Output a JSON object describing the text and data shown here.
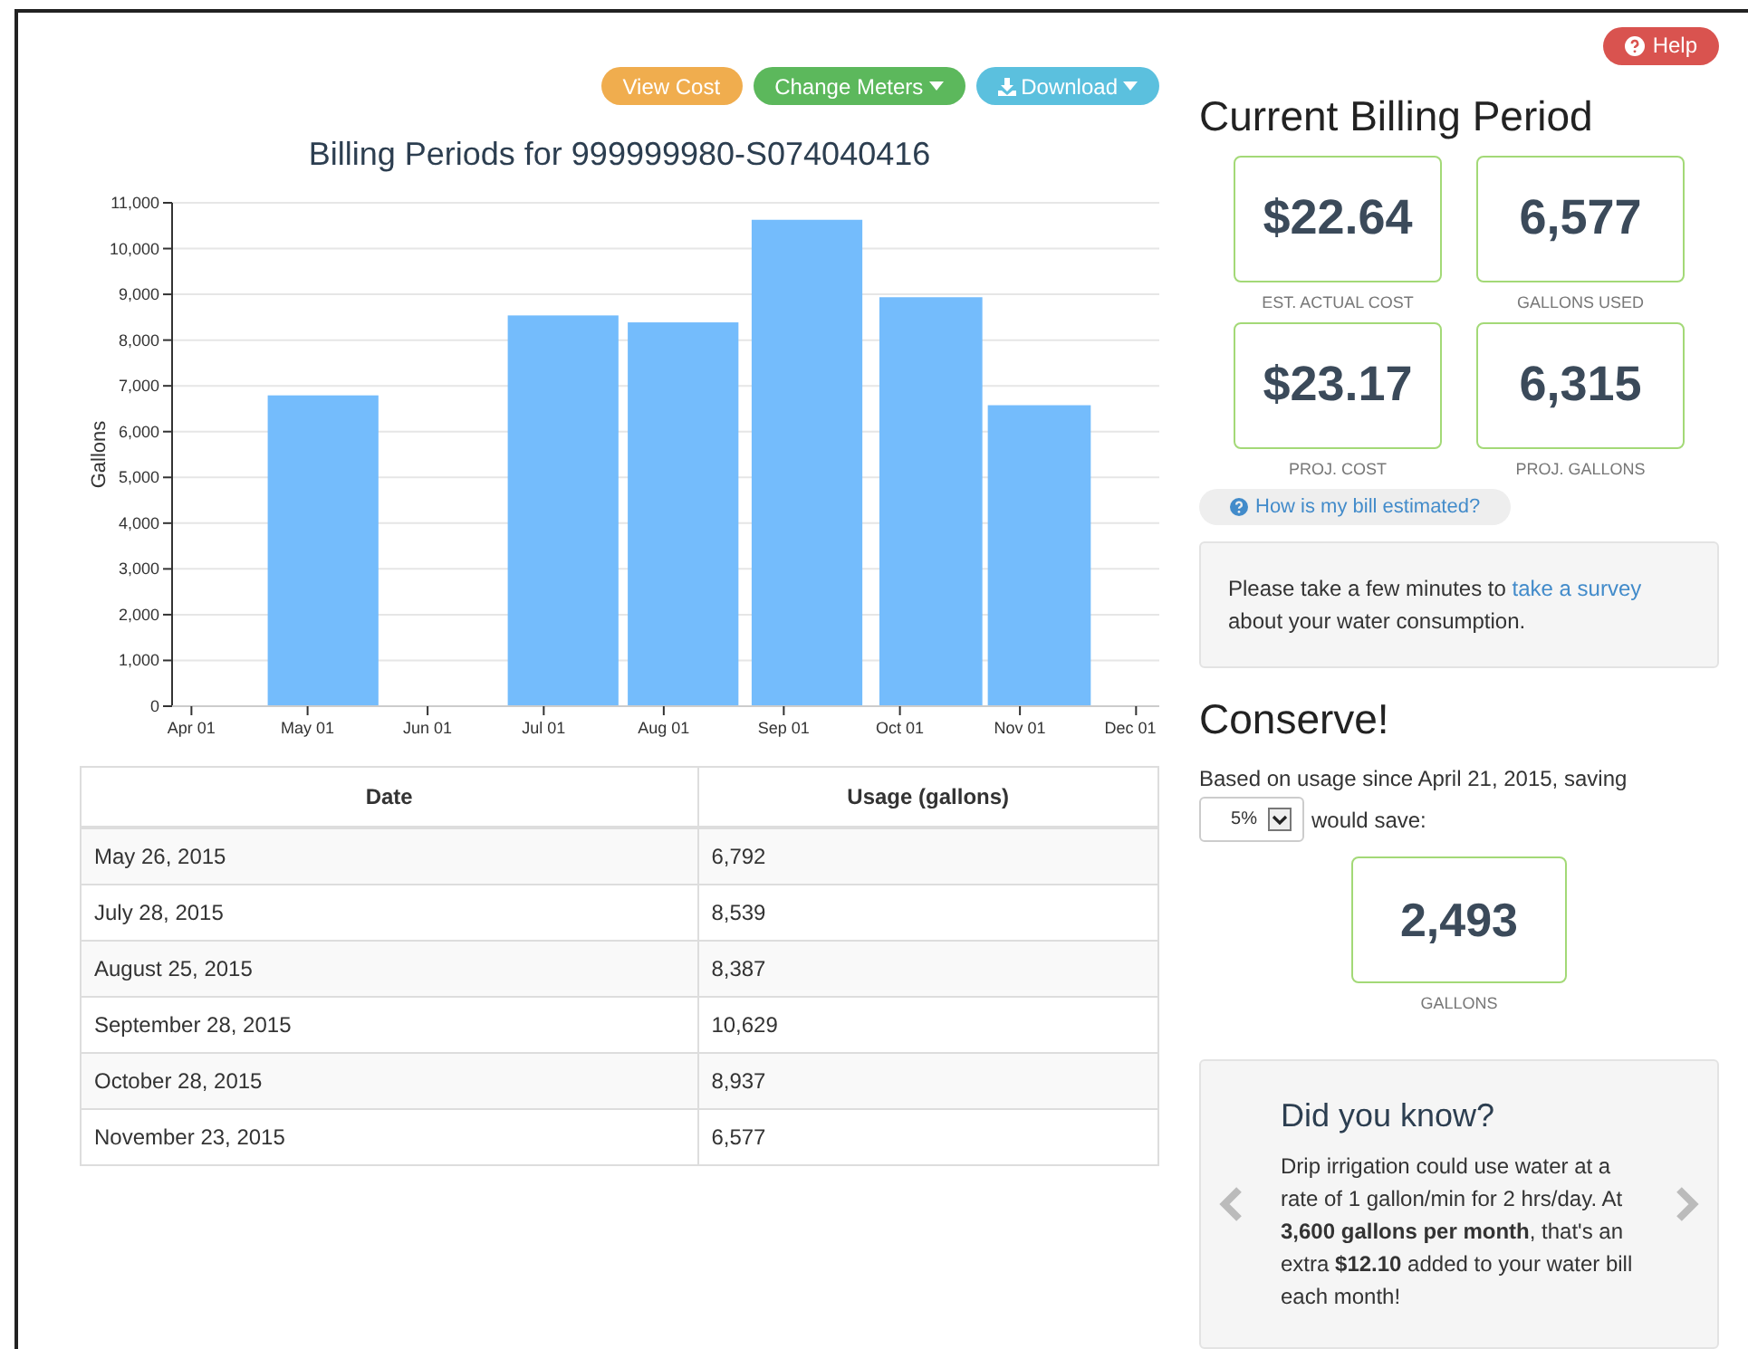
{
  "toolbar": {
    "buttons": [
      {
        "label": "View Cost",
        "kind": "plain",
        "color": "#f0ad4e"
      },
      {
        "label": "Change Meters",
        "kind": "dropdown",
        "color": "#5cb85c"
      },
      {
        "label": "Download",
        "kind": "download-dropdown",
        "color": "#5bc0de"
      }
    ]
  },
  "help_button": {
    "label": "Help"
  },
  "chart": {
    "title": "Billing Periods for 999999980-S074040416",
    "chart_data": {
      "type": "bar",
      "ylabel": "Gallons",
      "x": [
        "2015-05-05",
        "2015-07-06",
        "2015-08-06",
        "2015-09-07",
        "2015-10-09",
        "2015-11-06"
      ],
      "grid": true,
      "values": [
        6792,
        8539,
        8387,
        10629,
        8937,
        6577
      ],
      "ylim": [
        0,
        11000
      ],
      "yticks": [
        {
          "value": 0,
          "label": "0"
        },
        {
          "value": 1000,
          "label": "1,000"
        },
        {
          "value": 2000,
          "label": "2,000"
        },
        {
          "value": 3000,
          "label": "3,000"
        },
        {
          "value": 4000,
          "label": "4,000"
        },
        {
          "value": 5000,
          "label": "5,000"
        },
        {
          "value": 6000,
          "label": "6,000"
        },
        {
          "value": 7000,
          "label": "7,000"
        },
        {
          "value": 8000,
          "label": "8,000"
        },
        {
          "value": 9000,
          "label": "9,000"
        },
        {
          "value": 10000,
          "label": "10,000"
        },
        {
          "value": 11000,
          "label": "11,000"
        }
      ],
      "xlim": [
        "2015-03-27",
        "2015-12-07"
      ],
      "xticks": [
        {
          "value": "2015-04-01",
          "label": "Apr 01"
        },
        {
          "value": "2015-05-01",
          "label": "May 01"
        },
        {
          "value": "2015-06-01",
          "label": "Jun 01"
        },
        {
          "value": "2015-07-01",
          "label": "Jul 01"
        },
        {
          "value": "2015-08-01",
          "label": "Aug 01"
        },
        {
          "value": "2015-09-01",
          "label": "Sep 01"
        },
        {
          "value": "2015-10-01",
          "label": "Oct 01"
        },
        {
          "value": "2015-11-01",
          "label": "Nov 01"
        },
        {
          "value": "2015-12-01",
          "label": "Dec 01"
        }
      ]
    }
  },
  "table": {
    "columns": [
      "Date",
      "Usage (gallons)"
    ],
    "rows": [
      [
        "May 26, 2015",
        "6,792"
      ],
      [
        "July 28, 2015",
        "8,539"
      ],
      [
        "August 25, 2015",
        "8,387"
      ],
      [
        "September 28, 2015",
        "10,629"
      ],
      [
        "October 28, 2015",
        "8,937"
      ],
      [
        "November 23, 2015",
        "6,577"
      ]
    ]
  },
  "current_billing": {
    "title": "Current Billing Period",
    "cards": [
      {
        "value": "$22.64",
        "label": "EST. ACTUAL COST"
      },
      {
        "value": "6,577",
        "label": "GALLONS USED"
      },
      {
        "value": "$23.17",
        "label": "PROJ. COST"
      },
      {
        "value": "6,315",
        "label": "PROJ. GALLONS"
      }
    ],
    "estimate_link": "How is my bill estimated?",
    "survey": {
      "before": "Please take a few minutes to",
      "link": "take a survey",
      "after": "about your water consumption."
    }
  },
  "conserve": {
    "title": "Conserve!",
    "intro": "Based on usage since April 21, 2015, saving",
    "percent": "5%",
    "after": "would save:",
    "result": {
      "value": "2,493",
      "label": "GALLONS"
    }
  },
  "tip": {
    "title": "Did you know?",
    "body": "Drip irrigation could use water at a rate of 1 gallon/min for 2 hrs/day. At **3,600 gallons per month**, that's an extra **$12.10** added to your water bill each month!"
  }
}
